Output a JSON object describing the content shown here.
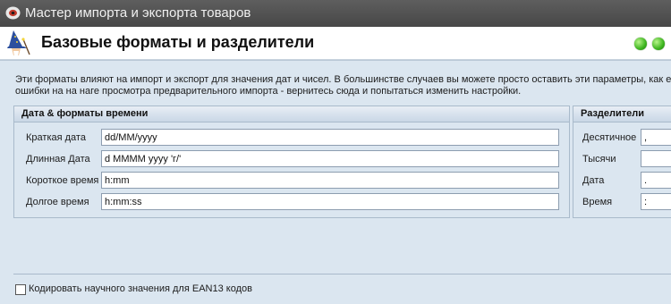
{
  "window": {
    "title": "Мастер импорта и экспорта товаров"
  },
  "header": {
    "title": "Базовые форматы и разделители"
  },
  "intro": {
    "line1": "Эти форматы влияют на импорт и экспорт для значения дат и чисел. В большинстве случаев вы можете просто оставить эти параметры, как е",
    "line2": "ошибки на на наге просмотра предварительного импорта - вернитесь сюда и попытаться изменить настройки."
  },
  "date_formats": {
    "title": "Дата & форматы времени",
    "short_date": {
      "label": "Краткая дата",
      "value": "dd/MM/yyyy"
    },
    "long_date": {
      "label": "Длинная Дата",
      "value": "d MMMM yyyy 'г/'"
    },
    "short_time": {
      "label": "Короткое время",
      "value": "h:mm"
    },
    "long_time": {
      "label": "Долгое время",
      "value": "h:mm:ss"
    }
  },
  "separators": {
    "title": "Разделители",
    "decimal": {
      "label": "Десятичное",
      "value": ","
    },
    "thousands": {
      "label": "Тысячи",
      "value": ""
    },
    "date": {
      "label": "Дата",
      "value": "."
    },
    "time": {
      "label": "Время",
      "value": ":"
    }
  },
  "ean13": {
    "label": "Кодировать научного значения для EAN13 кодов",
    "checked": false
  },
  "colors": {
    "titlebar": "#4f4f4f",
    "content_bg": "#dbe6f0",
    "status_dot": "#3cb41e"
  }
}
